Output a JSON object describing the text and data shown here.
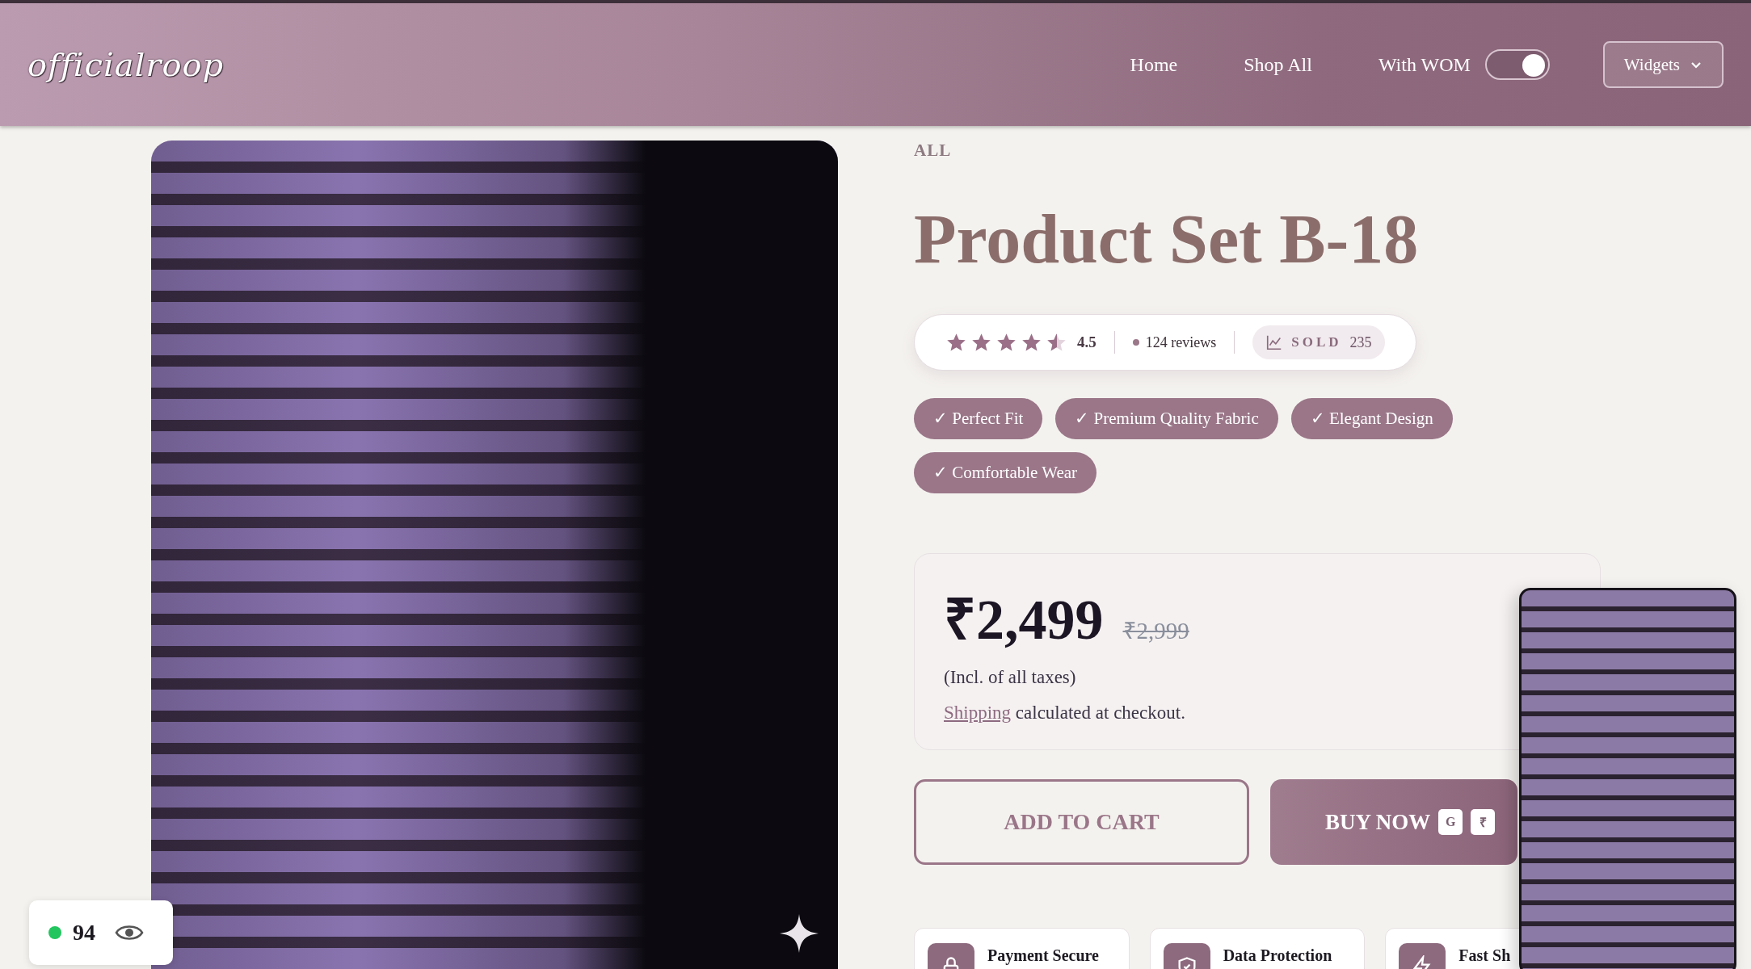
{
  "header": {
    "logo": "officialroop",
    "nav": [
      {
        "label": "Home"
      },
      {
        "label": "Shop All"
      }
    ],
    "wom_toggle": {
      "label": "With WOM",
      "on": true
    },
    "widgets_button": {
      "label": "Widgets"
    }
  },
  "product": {
    "breadcrumb": "ALL",
    "title": "Product Set B-18",
    "rating": {
      "stars": 4.5,
      "value": "4.5",
      "reviews": "124 reviews",
      "sold_label": "SOLD",
      "sold_count": "235"
    },
    "tags": [
      {
        "label": "✓ Perfect Fit"
      },
      {
        "label": "✓ Premium Quality Fabric"
      },
      {
        "label": "✓ Elegant Design"
      },
      {
        "label": "✓ Comfortable Wear"
      }
    ],
    "price": {
      "current": "₹2,499",
      "original": "₹2,999",
      "tax_note": "(Incl. of all taxes)",
      "shipping_link": "Shipping",
      "shipping_text": "calculated at checkout."
    },
    "buttons": {
      "add_to_cart": "ADD TO CART",
      "buy_now": "BUY NOW",
      "buy_badges": [
        "G",
        "₹"
      ]
    },
    "features": [
      {
        "kind": "lock",
        "label": "Payment Secure"
      },
      {
        "kind": "shield",
        "label": "Data Protection"
      },
      {
        "kind": "bolt",
        "label": "Fast Sh"
      }
    ]
  },
  "viewer_widget": {
    "count": "94"
  }
}
